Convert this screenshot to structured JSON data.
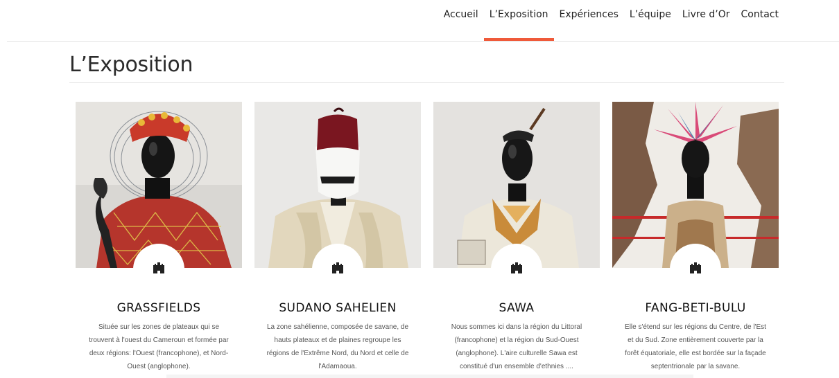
{
  "nav": {
    "items": [
      {
        "label": "Accueil",
        "active": false
      },
      {
        "label": "L’Exposition",
        "active": true
      },
      {
        "label": "Expériences",
        "active": false
      },
      {
        "label": "L’équipe",
        "active": false
      },
      {
        "label": "Livre d’Or",
        "active": false
      },
      {
        "label": "Contact",
        "active": false
      }
    ],
    "accent_color": "#ef5a3a"
  },
  "page": {
    "title": "L’Exposition"
  },
  "cards": [
    {
      "title": "GRASSFIELDS",
      "description": "Située sur les zones de plateaux qui se trouvent à l'ouest du Cameroun et formée par deux régions: l'Ouest (francophone), et Nord-Ouest (anglophone).",
      "icon": "castle-icon"
    },
    {
      "title": "SUDANO SAHELIEN",
      "description": "La zone sahélienne, composée de savane, de hauts plateaux et de plaines regroupe les régions de l'Extrême Nord, du Nord et celle de l'Adamaoua.",
      "icon": "castle-icon"
    },
    {
      "title": "SAWA",
      "description": "Nous sommes ici dans la région du Littoral (francophone) et la région du Sud-Ouest (anglophone). L'aire culturelle Sawa est constitué d'un ensemble d'ethnies ....",
      "icon": "castle-icon"
    },
    {
      "title": "FANG-BETI-BULU",
      "description": "Elle s'étend sur les régions du Centre, de l'Est et du Sud. Zone entièrement couverte par la forêt équatoriale, elle est bordée sur la façade septentrionale par la savane.",
      "icon": "castle-icon"
    }
  ]
}
